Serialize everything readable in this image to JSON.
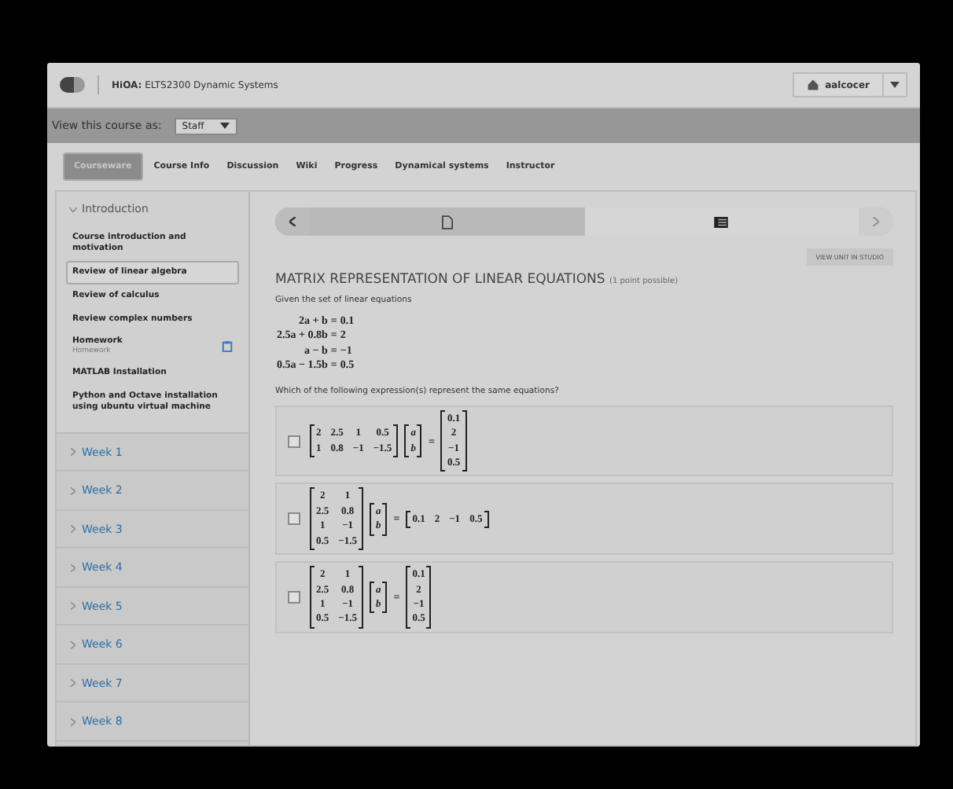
{
  "header": {
    "org": "HiOA:",
    "course": "ELTS2300 Dynamic Systems",
    "user": "aalcocer"
  },
  "view_as": {
    "label": "View this course as:",
    "value": "Staff"
  },
  "course_tabs": [
    {
      "label": "Courseware",
      "selected": true
    },
    {
      "label": "Course Info",
      "selected": false
    },
    {
      "label": "Discussion",
      "selected": false
    },
    {
      "label": "Wiki",
      "selected": false
    },
    {
      "label": "Progress",
      "selected": false
    },
    {
      "label": "Dynamical systems",
      "selected": false
    },
    {
      "label": "Instructor",
      "selected": false
    }
  ],
  "sidebar": {
    "sections": [
      {
        "title": "Introduction",
        "expanded": true,
        "items": [
          {
            "title": "Course introduction and motivation",
            "selected": false,
            "graded": false
          },
          {
            "title": "Review of linear algebra",
            "selected": true,
            "graded": false
          },
          {
            "title": "Review of calculus",
            "selected": false,
            "graded": false
          },
          {
            "title": "Review complex numbers",
            "selected": false,
            "graded": false
          },
          {
            "title": "Homework",
            "subtitle": "Homework",
            "selected": false,
            "graded": true
          },
          {
            "title": "MATLAB Installation",
            "selected": false,
            "graded": false
          },
          {
            "title": "Python and Octave installation using ubuntu virtual machine",
            "selected": false,
            "graded": false
          }
        ]
      },
      {
        "title": "Week 1",
        "expanded": false
      },
      {
        "title": "Week 2",
        "expanded": false
      },
      {
        "title": "Week 3",
        "expanded": false
      },
      {
        "title": "Week 4",
        "expanded": false
      },
      {
        "title": "Week 5",
        "expanded": false
      },
      {
        "title": "Week 6",
        "expanded": false
      },
      {
        "title": "Week 7",
        "expanded": false
      },
      {
        "title": "Week 8",
        "expanded": false
      }
    ]
  },
  "sequence": {
    "units": [
      {
        "kind": "document",
        "selected": false
      },
      {
        "kind": "problem",
        "selected": true
      }
    ]
  },
  "studio_button": "VIEW UNIT IN STUDIO",
  "problem": {
    "title": "MATRIX REPRESENTATION OF LINEAR EQUATIONS",
    "points": "(1 point possible)",
    "intro": "Given the set of linear equations",
    "equations": [
      {
        "lhs": "2a + b",
        "relation": "=",
        "rhs": "0.1"
      },
      {
        "lhs": "2.5a + 0.8b",
        "relation": "=",
        "rhs": "2"
      },
      {
        "lhs": "a − b",
        "relation": "=",
        "rhs": "−1"
      },
      {
        "lhs": "0.5a − 1.5b",
        "relation": "=",
        "rhs": "0.5"
      }
    ],
    "question": "Which of the following expression(s) represent the same equations?",
    "options": [
      {
        "checked": false,
        "matrix": [
          [
            "2",
            "2.5",
            "1",
            "0.5"
          ],
          [
            "1",
            "0.8",
            "−1",
            "−1.5"
          ]
        ],
        "vector": [
          [
            "a"
          ],
          [
            "b"
          ]
        ],
        "relation": "=",
        "rhs": [
          [
            "0.1"
          ],
          [
            "2"
          ],
          [
            "−1"
          ],
          [
            "0.5"
          ]
        ]
      },
      {
        "checked": false,
        "matrix": [
          [
            "2",
            "1"
          ],
          [
            "2.5",
            "0.8"
          ],
          [
            "1",
            "−1"
          ],
          [
            "0.5",
            "−1.5"
          ]
        ],
        "vector": [
          [
            "a"
          ],
          [
            "b"
          ]
        ],
        "relation": "=",
        "rhs": [
          [
            "0.1",
            "2",
            "−1",
            "0.5"
          ]
        ]
      },
      {
        "checked": false,
        "matrix": [
          [
            "2",
            "1"
          ],
          [
            "2.5",
            "0.8"
          ],
          [
            "1",
            "−1"
          ],
          [
            "0.5",
            "−1.5"
          ]
        ],
        "vector": [
          [
            "a"
          ],
          [
            "b"
          ]
        ],
        "relation": "=",
        "rhs": [
          [
            "0.1"
          ],
          [
            "2"
          ],
          [
            "−1"
          ],
          [
            "0.5"
          ]
        ]
      }
    ]
  }
}
